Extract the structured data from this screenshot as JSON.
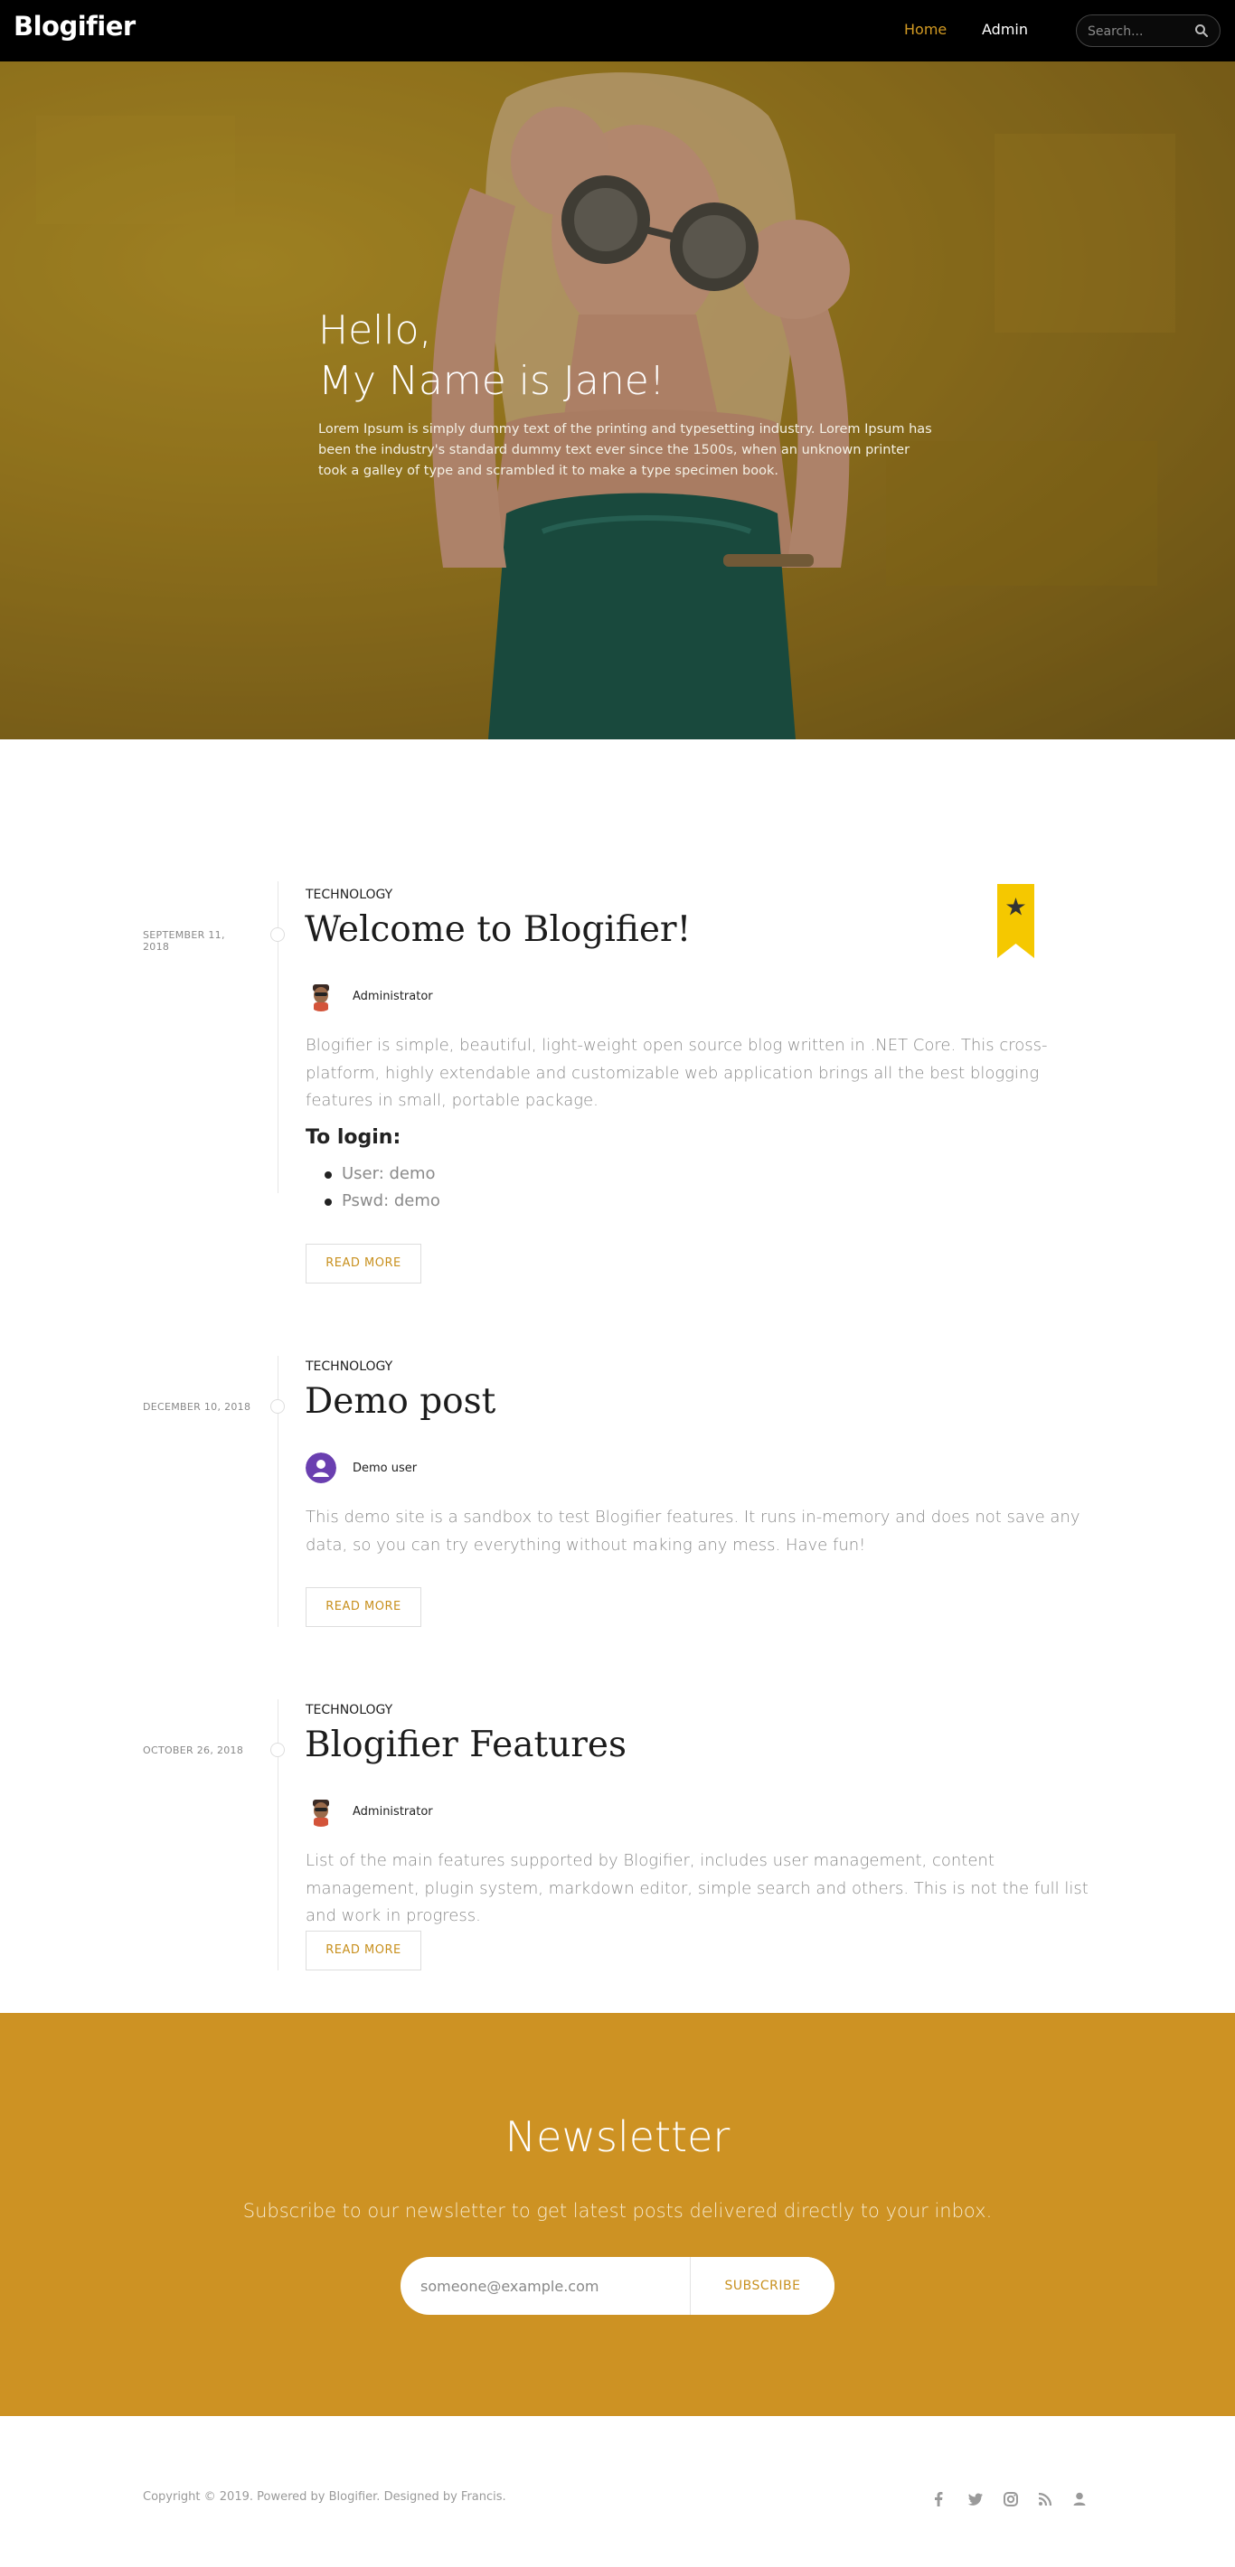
{
  "header": {
    "brand": "Blogifier",
    "nav": [
      {
        "label": "Home",
        "active": true
      },
      {
        "label": "Admin",
        "active": false
      }
    ],
    "search": {
      "placeholder": "Search..."
    }
  },
  "hero": {
    "title_line1": "Hello,",
    "title_line2": "My Name is Jane!",
    "description": "Lorem Ipsum is simply dummy text of the printing and typesetting industry. Lorem Ipsum has been the industry's standard dummy text ever since the 1500s, when an unknown printer took a galley of type and scrambled it to make a type specimen book."
  },
  "posts": [
    {
      "date": "SEPTEMBER 11, 2018",
      "category": "TECHNOLOGY",
      "title": "Welcome to Blogifier!",
      "author": "Administrator",
      "featured": true,
      "body": "Blogifier is simple, beautiful, light-weight open source blog written in .NET Core. This cross-platform, highly extendable and customizable web application brings all the best blogging features in small, portable package.",
      "subheading": "To login:",
      "list": [
        "User: demo",
        "Pswd: demo"
      ],
      "read_more": "READ MORE"
    },
    {
      "date": "DECEMBER 10, 2018",
      "category": "TECHNOLOGY",
      "title": "Demo post",
      "author": "Demo user",
      "featured": false,
      "body": "This demo site is a sandbox to test Blogifier features. It runs in-memory and does not save any data, so you can try everything without making any mess. Have fun!",
      "read_more": "READ MORE"
    },
    {
      "date": "OCTOBER 26, 2018",
      "category": "TECHNOLOGY",
      "title": "Blogifier Features",
      "author": "Administrator",
      "featured": false,
      "body": "List of the main features supported by Blogifier, includes user management, content management, plugin system, markdown editor, simple search and others. This is not the full list and work in progress.",
      "read_more": "READ MORE"
    }
  ],
  "newsletter": {
    "title": "Newsletter",
    "subtitle": "Subscribe to our newsletter to get latest posts delivered directly to your inbox.",
    "email_placeholder": "someone@example.com",
    "button": "SUBSCRIBE"
  },
  "footer": {
    "copyright": "Copyright © 2019. Powered by Blogifier. Designed by Francis.",
    "social_icons": [
      "facebook-icon",
      "twitter-icon",
      "instagram-icon",
      "rss-icon",
      "user-icon"
    ]
  },
  "colors": {
    "accent": "#cd9223",
    "nav_active": "#d29a23",
    "ribbon": "#f5c800",
    "header_bg": "#000000"
  }
}
